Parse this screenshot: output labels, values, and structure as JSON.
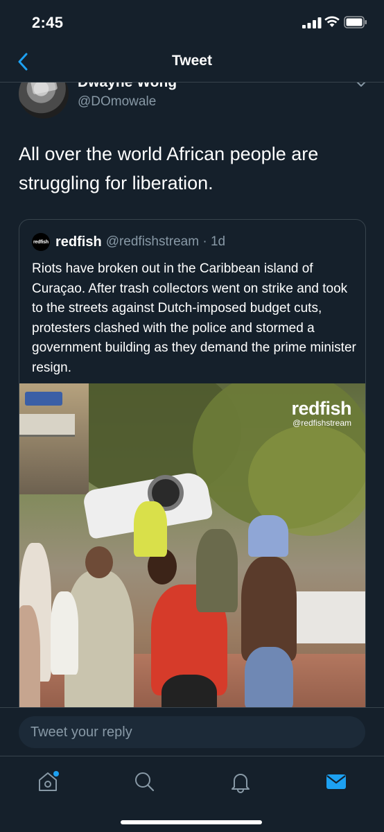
{
  "status_bar": {
    "time": "2:45",
    "icons": [
      "signal-icon",
      "wifi-icon",
      "battery-icon"
    ]
  },
  "header": {
    "title": "Tweet",
    "back_icon": "chevron-left-icon"
  },
  "tweet": {
    "author_name": "Dwayne Wong",
    "author_handle": "@DOmowale",
    "text": "All over the world African people are struggling for liberation."
  },
  "quoted_tweet": {
    "avatar_text": "redfish",
    "name": "redfish",
    "handle_time": "@redfishstream · 1d",
    "text": "Riots have broken out in the Caribbean island of Curaçao. After trash collectors went on strike and took to the streets against Dutch-imposed budget cuts, protesters clashed with the police and stormed a government building as they demand the prime minister resign.",
    "media": {
      "watermark_brand": "redfish",
      "watermark_handle": "@redfishstream"
    }
  },
  "reply": {
    "placeholder": "Tweet your reply"
  },
  "tab_bar": {
    "tabs": [
      {
        "icon": "home-icon",
        "active": false,
        "has_dot": true
      },
      {
        "icon": "search-icon",
        "active": false
      },
      {
        "icon": "bell-icon",
        "active": false
      },
      {
        "icon": "mail-icon",
        "active": true
      }
    ]
  },
  "colors": {
    "background": "#15202b",
    "border": "#38444d",
    "secondary_text": "#8899a6",
    "accent": "#1da1f2"
  }
}
